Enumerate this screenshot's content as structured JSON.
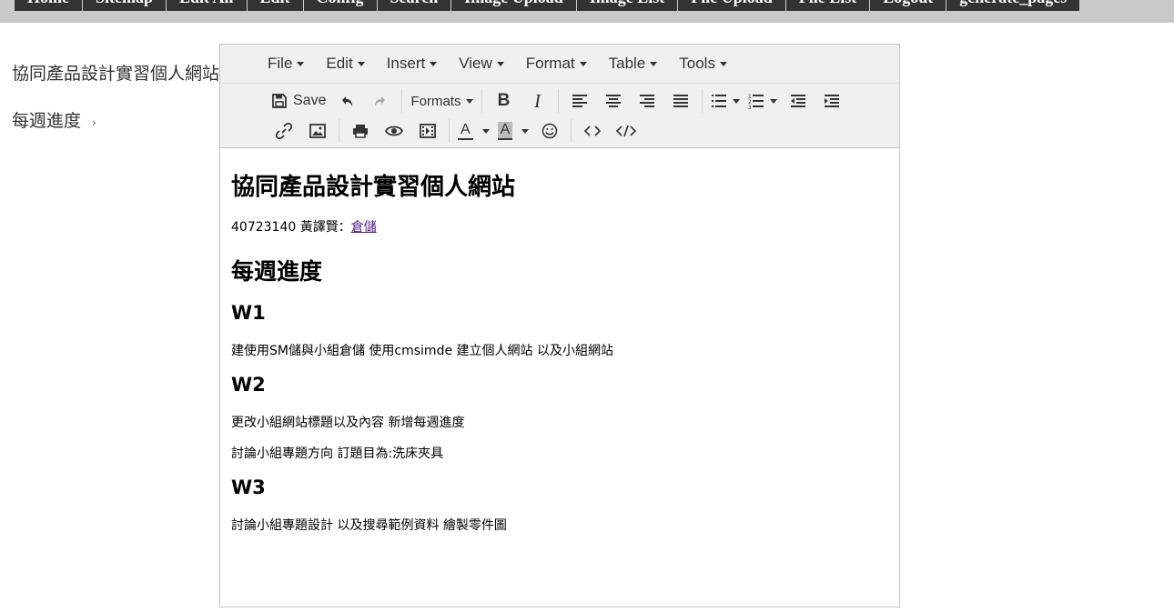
{
  "nav": {
    "items": [
      "Home",
      "Sitemap",
      "Edit All",
      "Edit",
      "Config",
      "Search",
      "Image Upload",
      "Image List",
      "File Upload",
      "File List",
      "Logout",
      "generate_pages"
    ]
  },
  "sidebar": {
    "items": [
      "協同產品設計實習個人網站",
      "每週進度"
    ]
  },
  "editor": {
    "menu": [
      "File",
      "Edit",
      "Insert",
      "View",
      "Format",
      "Table",
      "Tools"
    ],
    "toolbar": {
      "save_label": "Save",
      "formats_label": "Formats",
      "bold_label": "B",
      "italic_label": "I",
      "forecolor_label": "A",
      "backcolor_label": "A"
    },
    "content": {
      "title": "協同產品設計實習個人網站",
      "author_line": "40723140 黃譯賢：",
      "repo_link": "倉儲",
      "weekly_heading": "每週進度",
      "weeks": [
        {
          "label": "W1",
          "lines": [
            "建使用SM儲與小組倉儲 使用cmsimde 建立個人網站 以及小組網站"
          ]
        },
        {
          "label": "W2",
          "lines": [
            "更改小組網站標題以及內容 新增每週進度",
            "討論小組專題方向 訂題目為:洗床夾具"
          ]
        },
        {
          "label": "W3",
          "lines": [
            "討論小組專題設計 以及搜尋範例資料 繪製零件圖"
          ]
        }
      ]
    }
  },
  "colors": {
    "nav_bg": "#333333",
    "topbar_bg": "#c9c9c9",
    "toolbar_bg": "#f0f0f0",
    "link": "#551a8b"
  }
}
